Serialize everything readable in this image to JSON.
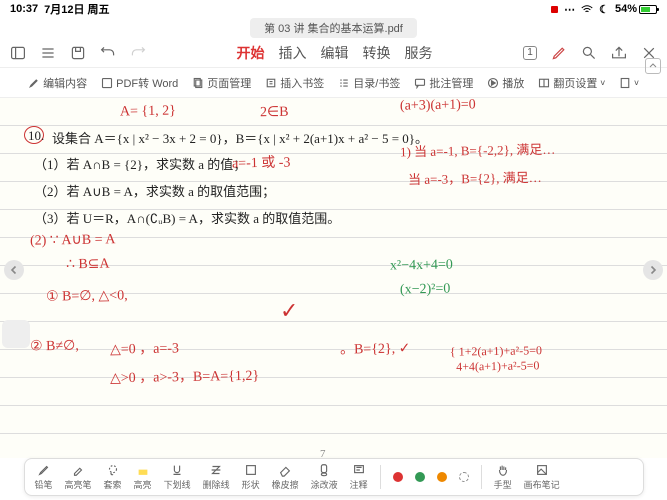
{
  "status": {
    "time": "10:37",
    "date": "7月12日 周五",
    "battery": "54%"
  },
  "tab": "第 03 讲 集合的基本运算.pdf",
  "menu": {
    "start": "开始",
    "insert": "插入",
    "edit": "编辑",
    "convert": "转换",
    "service": "服务"
  },
  "sub": {
    "editContent": "编辑内容",
    "pdfWord": "PDF转 Word",
    "pageMgr": "页面管理",
    "bookmark": "插入书签",
    "toc": "目录/书签",
    "annot": "批注管理",
    "play": "播放",
    "flipSet": "翻页设置"
  },
  "printed": {
    "q10": "10.",
    "main": "设集合 A＝{x | x² − 3x + 2 = 0}，B＝{x | x² + 2(a+1)x + a² − 5 = 0}。",
    "p1": "（1）若 A∩B = {2}，求实数 a 的值；",
    "p2": "（2）若 A∪B = A，求实数 a 的取值范围；",
    "p3": "（3）若 U＝R，A∩(∁ᵤB) = A，求实数 a 的取值范围。",
    "page": "7"
  },
  "hand": {
    "aset": "A= {1, 2}",
    "twoB": "2∈B",
    "prod": "(a+3)(a+1)=0",
    "ans1": "a=-1 或 -3",
    "note11": "1) 当 a=-1, B={-2,2}, 满足…",
    "note12": "当 a=-3，B={2}, 满足…",
    "hdr2": "(2) ∵ A∪B = A",
    "sub2": "∴ B⊆A",
    "case1": "① B=∅, △<0,",
    "check": "✓",
    "green1": "x²−4x+4=0",
    "green2": "(x−2)²=0",
    "case2": "② B≠∅, ",
    "d0": "△=0 ，a=-3",
    "dg": "△>0 ，a>-3，B=A={1,2}",
    "bonly": "。B={2}, ✓",
    "sys": "{ 1+2(a+1)+a²-5=0\n  4+4(a+1)+a²-5=0"
  },
  "tools": {
    "pencil": "铅笔",
    "hl": "高亮笔",
    "lasso": "套索",
    "hl2": "高亮",
    "ul": "下划线",
    "strike": "删除线",
    "shape": "形状",
    "eraser": "橡皮擦",
    "white": "涂改液",
    "note": "注释",
    "hand": "手型",
    "canvas": "画布笔记"
  }
}
